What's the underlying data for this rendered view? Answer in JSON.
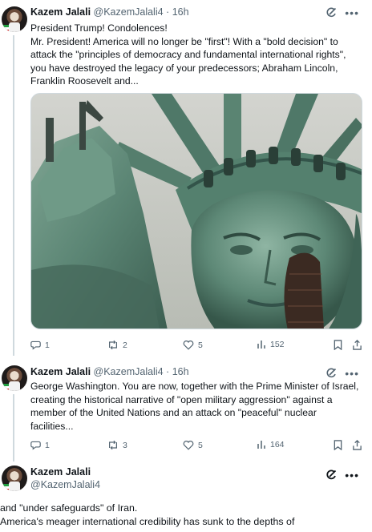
{
  "tweets": [
    {
      "name": "Kazem Jalali",
      "handle": "@KazemJalali4",
      "sep": "·",
      "time": "16h",
      "text_lines": [
        "President Trump! Condolences!",
        "Mr. President! America will no longer be \"first\"! With a \"bold decision\" to",
        "attack the \"principles of democracy and fundamental international rights\",",
        "you have destroyed the legacy of your predecessors; Abraham Lincoln,",
        "Franklin Roosevelt and..."
      ],
      "media_description": "statue-of-liberty-damaged",
      "replies": "1",
      "reposts": "2",
      "likes": "5",
      "views": "152"
    },
    {
      "name": "Kazem Jalali",
      "handle": "@KazemJalali4",
      "sep": "·",
      "time": "16h",
      "text_lines": [
        "George Washington. You are now, together with the Prime Minister of Israel,",
        "creating the historical narrative of \"open military aggression\" against a",
        "member of the United Nations and an attack on \"peaceful\" nuclear",
        "facilities..."
      ],
      "replies": "1",
      "reposts": "3",
      "likes": "5",
      "views": "164"
    },
    {
      "name": "Kazem Jalali",
      "handle": "@KazemJalali4",
      "continued_lines": [
        "and \"under safeguards\" of Iran.",
        "America's meager international credibility has sunk to the depths of"
      ]
    }
  ],
  "icons": {
    "grok": "grok-icon",
    "more": "more-dots-icon",
    "reply": "reply-icon",
    "repost": "repost-icon",
    "like": "heart-icon",
    "views": "views-chart-icon",
    "bookmark": "bookmark-icon",
    "share": "share-icon"
  },
  "colors": {
    "text": "#0f1419",
    "secondary": "#536471",
    "thread_line": "#cfd9de"
  }
}
